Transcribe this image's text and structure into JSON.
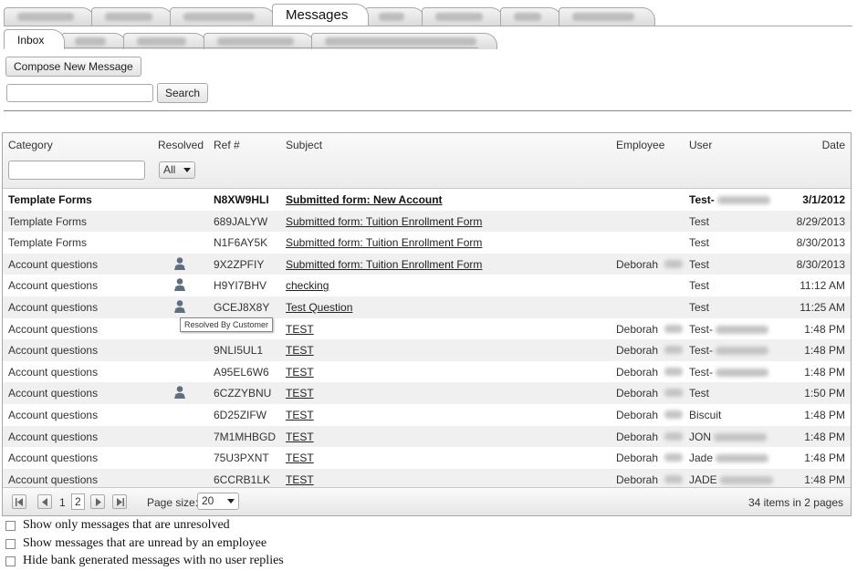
{
  "tabs_top": [
    {
      "label": "",
      "blur_w": 62,
      "active": false
    },
    {
      "label": "",
      "blur_w": 52,
      "active": false
    },
    {
      "label": "",
      "blur_w": 78,
      "active": false
    },
    {
      "label": "Messages",
      "blur_w": 0,
      "active": true
    },
    {
      "label": "",
      "blur_w": 28,
      "active": false
    },
    {
      "label": "",
      "blur_w": 52,
      "active": false
    },
    {
      "label": "",
      "blur_w": 30,
      "active": false
    },
    {
      "label": "",
      "blur_w": 68,
      "active": false
    }
  ],
  "tabs_sub": [
    {
      "label": "Inbox",
      "blur_w": 0,
      "active": true
    },
    {
      "label": "",
      "blur_w": 34,
      "active": false
    },
    {
      "label": "",
      "blur_w": 54,
      "active": false
    },
    {
      "label": "",
      "blur_w": 84,
      "active": false
    },
    {
      "label": "",
      "blur_w": 166,
      "active": false
    }
  ],
  "compose_label": "Compose New Message",
  "search": {
    "value": "",
    "button_label": "Search"
  },
  "grid": {
    "headers": {
      "category": "Category",
      "resolved": "Resolved",
      "ref": "Ref #",
      "subject": "Subject",
      "employee": "Employee",
      "user": "User",
      "date": "Date"
    },
    "filter": {
      "category_value": "",
      "resolved_value": "All"
    },
    "rows": [
      {
        "category": "Template Forms",
        "resolved": false,
        "ref": "N8XW9HLI",
        "subject": "Submitted form: New Account",
        "employee": "",
        "user": "Test-",
        "user_blur": true,
        "date": "3/1/2012",
        "bold": true
      },
      {
        "category": "Template Forms",
        "resolved": false,
        "ref": "689JALYW",
        "subject": "Submitted form: Tuition Enrollment Form",
        "employee": "",
        "user": "Test",
        "user_blur": false,
        "date": "8/29/2013",
        "bold": false
      },
      {
        "category": "Template Forms",
        "resolved": false,
        "ref": "N1F6AY5K",
        "subject": "Submitted form: Tuition Enrollment Form",
        "employee": "",
        "user": "Test",
        "user_blur": false,
        "date": "8/30/2013",
        "bold": false
      },
      {
        "category": "Account questions",
        "resolved": true,
        "ref": "9X2ZPFIY",
        "subject": "Submitted form: Tuition Enrollment Form",
        "employee": "Deborah",
        "user": "Test",
        "user_blur": false,
        "date": "8/30/2013",
        "bold": false
      },
      {
        "category": "Account questions",
        "resolved": true,
        "ref": "H9YI7BHV",
        "subject": "checking",
        "employee": "",
        "user": "Test",
        "user_blur": false,
        "date": "11:12 AM",
        "bold": false
      },
      {
        "category": "Account questions",
        "resolved": true,
        "ref": "GCEJ8X8Y",
        "subject": "Test Question",
        "employee": "",
        "user": "Test",
        "user_blur": false,
        "date": "11:25 AM",
        "bold": false
      },
      {
        "category": "Account questions",
        "resolved": false,
        "ref": "",
        "subject": "TEST",
        "employee": "Deborah",
        "user": "Test-",
        "user_blur": true,
        "date": "1:48 PM",
        "bold": false
      },
      {
        "category": "Account questions",
        "resolved": false,
        "ref": "9NLI5UL1",
        "subject": "TEST",
        "employee": "Deborah",
        "user": "Test-",
        "user_blur": true,
        "date": "1:48 PM",
        "bold": false
      },
      {
        "category": "Account questions",
        "resolved": false,
        "ref": "A95EL6W6",
        "subject": "TEST",
        "employee": "Deborah",
        "user": "Test-",
        "user_blur": true,
        "date": "1:48 PM",
        "bold": false
      },
      {
        "category": "Account questions",
        "resolved": true,
        "ref": "6CZZYBNU",
        "subject": "TEST",
        "employee": "Deborah",
        "user": "Test",
        "user_blur": false,
        "date": "1:50 PM",
        "bold": false
      },
      {
        "category": "Account questions",
        "resolved": false,
        "ref": "6D25ZIFW",
        "subject": "TEST",
        "employee": "Deborah",
        "user": "Biscuit",
        "user_blur": false,
        "date": "1:48 PM",
        "bold": false
      },
      {
        "category": "Account questions",
        "resolved": false,
        "ref": "7M1MHBGD",
        "subject": "TEST",
        "employee": "Deborah",
        "user": "JON",
        "user_blur": true,
        "date": "1:48 PM",
        "bold": false
      },
      {
        "category": "Account questions",
        "resolved": false,
        "ref": "75U3PXNT",
        "subject": "TEST",
        "employee": "Deborah",
        "user": "Jade",
        "user_blur": true,
        "date": "1:48 PM",
        "bold": false
      },
      {
        "category": "Account questions",
        "resolved": false,
        "ref": "6CCRB1LK",
        "subject": "TEST",
        "employee": "Deborah",
        "user": "JADE",
        "user_blur": true,
        "date": "1:48 PM",
        "bold": false
      }
    ],
    "tooltip": "Resolved By Customer",
    "pager": {
      "pages": [
        "1",
        "2"
      ],
      "current": "2",
      "page_size_label": "Page size:",
      "page_size": "20",
      "summary": "34 items in 2 pages"
    }
  },
  "options": [
    "Show only messages that are unresolved",
    "Show messages that are unread by an employee",
    "Hide bank generated messages with no user replies"
  ]
}
